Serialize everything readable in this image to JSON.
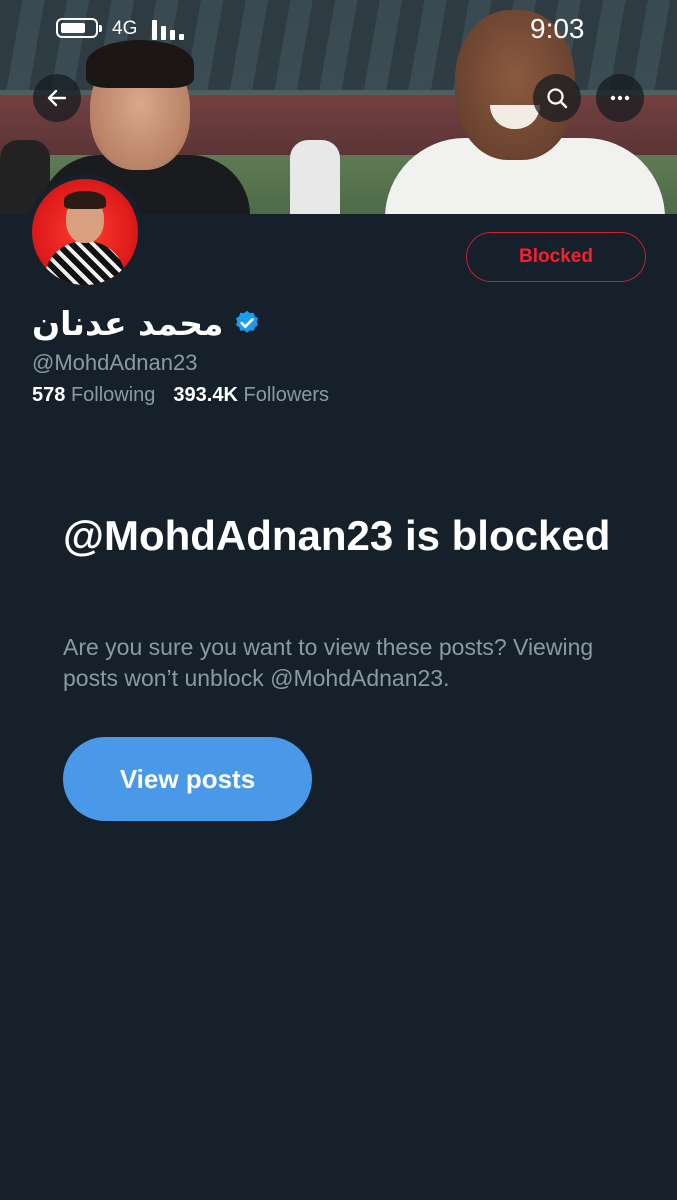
{
  "status_bar": {
    "network": "4G",
    "time": "9:03"
  },
  "profile": {
    "display_name": "محمد عدنان",
    "handle": "@MohdAdnan23",
    "blocked_label": "Blocked",
    "following_count": "578",
    "following_label": "Following",
    "followers_count": "393.4K",
    "followers_label": "Followers"
  },
  "blocked_notice": {
    "title": "@MohdAdnan23 is blocked",
    "description": "Are you sure you want to view these posts? Viewing posts won’t unblock @MohdAdnan23.",
    "button_label": "View posts"
  },
  "icons": {
    "back": "arrow-left-icon",
    "search": "search-icon",
    "more": "more-horizontal-icon",
    "verified": "verified-badge-icon"
  },
  "colors": {
    "background": "#16202b",
    "accent": "#4a99e9",
    "blocked": "#f4212e",
    "verified": "#1d9bf0"
  }
}
